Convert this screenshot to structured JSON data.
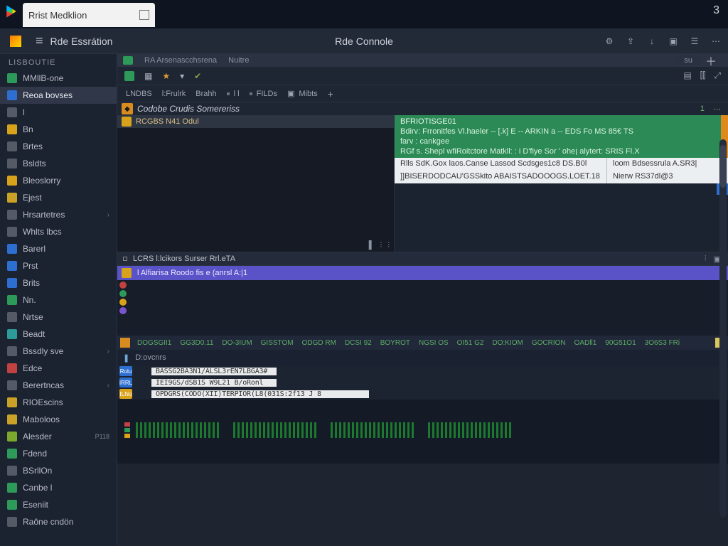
{
  "titlebar": {
    "tab_label": "Rrist Medklion",
    "right_indicator": "3"
  },
  "header": {
    "app_name": "Rde Essrátion",
    "center_title": "Rde Connole",
    "right_icons": [
      "settings",
      "share",
      "download",
      "panel",
      "layout",
      "more"
    ]
  },
  "subtabs": {
    "a": "RA  Arsenascchsrena",
    "b": "Nuitre",
    "search_hint": "su"
  },
  "tbar2": {
    "a": "LNDBS",
    "b": "l:Frulrk",
    "c": "Brahh",
    "d": "l l",
    "e": "FILDs",
    "f": "Mibts"
  },
  "ob": {
    "label": "Codobe Crudis Somereriss",
    "right_a": "1",
    "right_b": "⋯"
  },
  "cp": {
    "bar": "RCGBS N41 Odul"
  },
  "ro": {
    "head": "BFRIOTISGE01",
    "l1": "Bdirv: Frronitfes Vl.haeler -- [.k] E -- ARKIN a -- EDS Fo MS 85€ TS",
    "l2": "farv : cankgee",
    "l3": "RGf s.  Shepl wfiRoitctore Matkll: : i    D'fiye Sor ' oheן alytert: SRIS Fl.X",
    "w1a": "Rlls SdK.Gox laos.Canse Lassod Scdsges1c8 DS.B0l",
    "w1b": "loom Bdsessrula A.SR3|",
    "w2a": "]]BISERDODCAU'GSSkito ABAISTSADOOOGS.LOET.18",
    "w2b": "Nierw RS37dl@3"
  },
  "mid": {
    "label": "LCRS l:lcikors Surser Rrl.eTA"
  },
  "purple": {
    "label": "l Alfiarisa Roodo fis e (anrsl A:|1"
  },
  "ruler": {
    "cells": [
      "DOGSGII1",
      "GG3D0.11",
      "DO-3IUM",
      "GISSTOM",
      "ODGD RM",
      "DCSI 92",
      "BOYROT",
      "NGSI OS",
      "OI51 G2",
      "DO:KIOM",
      "GOCRION",
      "OADll1",
      "90G51O1",
      "3O6S3 FRi"
    ]
  },
  "out": {
    "head": "D:ovcnrs",
    "r1_tag": "Rolu",
    "r1": "BASSG2BA3N1/ALSL3rEN7LBGA3#",
    "r2_tag": "IRRL",
    "r2": "IEI9GS/dSB1S W9L21 B/oRonl",
    "r3_tag": "ILNo",
    "r3": "OPDGRS(CODO(XII)TERPIOR(L8(031S:2f13  J 8"
  },
  "sidebar": {
    "group_a": "LISBOUTIE",
    "items": [
      {
        "label": "MMllB-one",
        "color": "c-green"
      },
      {
        "label": "Reoa bovses",
        "color": "c-blue",
        "selected": true
      },
      {
        "label": "l",
        "color": "c-grey"
      },
      {
        "label": "Bn",
        "color": "c-yellow"
      },
      {
        "label": "Brtes",
        "color": "c-grey"
      },
      {
        "label": "Bsldts",
        "color": "c-grey"
      },
      {
        "label": "Bleoslorry",
        "color": "c-yellow"
      },
      {
        "label": "Ejest",
        "color": "c-gold"
      },
      {
        "label": "Hrsartetres",
        "color": "c-grey",
        "chev": true
      },
      {
        "label": "Whlts lbcs",
        "color": "c-grey"
      },
      {
        "label": "Barerl",
        "color": "c-blue"
      },
      {
        "label": "Prst",
        "color": "c-blue"
      },
      {
        "label": "Brits",
        "color": "c-blue"
      },
      {
        "label": "Nn.",
        "color": "c-green"
      },
      {
        "label": "Nrtse",
        "color": "c-grey"
      },
      {
        "label": "Beadt",
        "color": "c-teal"
      },
      {
        "label": "Bssdly sve",
        "color": "c-grey",
        "chev": true
      },
      {
        "label": "Edce",
        "color": "c-red"
      },
      {
        "label": "Berertncas",
        "color": "c-grey",
        "chev": true
      },
      {
        "label": "RIOEscins",
        "color": "c-gold"
      },
      {
        "label": "Maboloos",
        "color": "c-gold"
      },
      {
        "label": "Alesder",
        "color": "c-lime",
        "badge": "P118"
      },
      {
        "label": "Fdend",
        "color": "c-green"
      },
      {
        "label": "BSrllOn",
        "color": "c-grey"
      },
      {
        "label": "Canbe l",
        "color": "c-green"
      },
      {
        "label": "Eseniit",
        "color": "c-green"
      },
      {
        "label": "Raône cndӧn",
        "color": "c-grey"
      }
    ]
  }
}
